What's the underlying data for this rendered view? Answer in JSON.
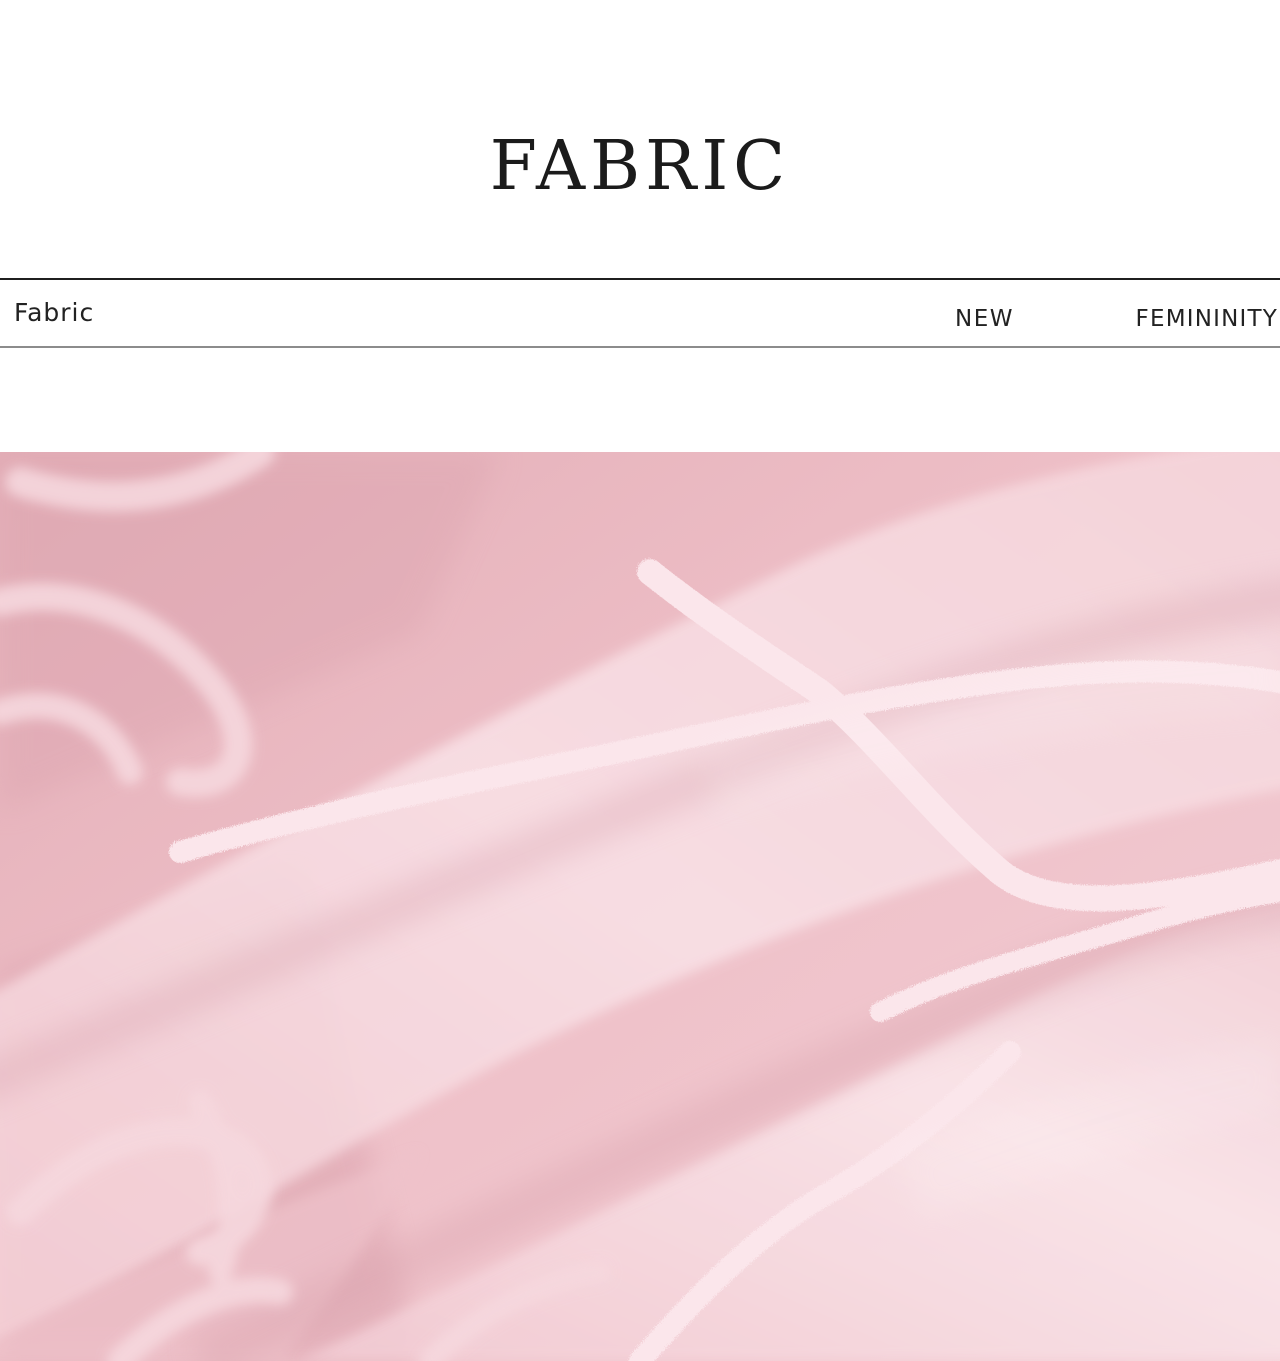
{
  "header": {
    "title": "FABRIC"
  },
  "band": {
    "label": "Fabric",
    "tags": [
      "NEW",
      "FEMININITY"
    ]
  },
  "photo": {
    "subject": "pink-fabric-closeup",
    "colors": {
      "base": "#e9b7bf",
      "highlight": "#f7dfe4",
      "shadow": "#d49aa6",
      "chenille": "#fbe5ea"
    }
  }
}
